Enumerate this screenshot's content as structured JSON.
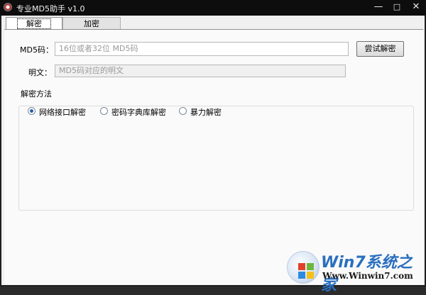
{
  "window": {
    "title": "专业MD5助手 v1.0",
    "minimize_glyph": "—",
    "maximize_glyph": "□",
    "close_glyph": "✕"
  },
  "tabs": [
    {
      "label": "解密",
      "selected": true
    },
    {
      "label": "加密",
      "selected": false
    }
  ],
  "form": {
    "md5_label": "MD5码：",
    "md5_placeholder": "16位或者32位 MD5码",
    "decrypt_button": "尝试解密",
    "plaintext_label": "明文：",
    "plaintext_placeholder": "MD5码对应的明文"
  },
  "method_group": {
    "title": "解密方法",
    "options": [
      {
        "label": "网络接口解密",
        "checked": true
      },
      {
        "label": "密码字典库解密",
        "checked": false
      },
      {
        "label": "暴力解密",
        "checked": false
      }
    ]
  },
  "watermark": {
    "brand": "Win7系统之家",
    "url": "Www.Winwin7.com"
  },
  "colors": {
    "titlebar": "#0d0d0d",
    "window_bg": "#f0f0f0",
    "radio_checked": "#2a5ea8",
    "brand_blue": "#2a6fbf"
  }
}
